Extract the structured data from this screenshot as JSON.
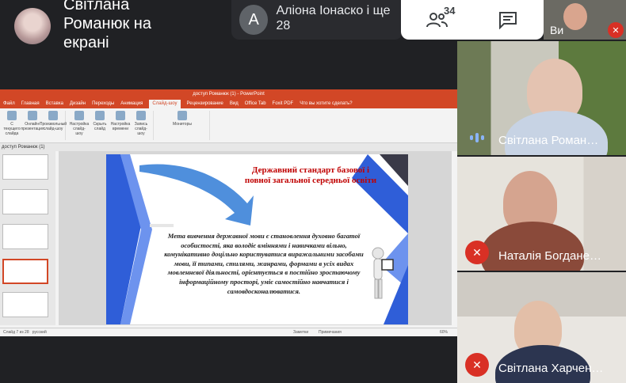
{
  "meet": {
    "presenter_label": "Світлана Романюк на екрані",
    "others_label": "Аліона Іонаско і ще 28",
    "others_initial": "A",
    "participant_count": "34",
    "self_label": "Ви"
  },
  "tiles": [
    {
      "name": "Світлана Роман…",
      "state": "speaking"
    },
    {
      "name": "Наталія Богдане…",
      "state": "muted"
    },
    {
      "name": "Світлана Харчен…",
      "state": "muted"
    }
  ],
  "powerpoint": {
    "window_title": "доступ Романюк (1) - PowerPoint",
    "tabs": [
      "Файл",
      "Главная",
      "Вставка",
      "Дизайн",
      "Переходы",
      "Анимация",
      "Слайд-шоу",
      "Рецензирование",
      "Вид",
      "Office Tab",
      "Foxit PDF",
      "Что вы хотите сделать?"
    ],
    "active_tab": "Слайд-шоу",
    "doc_tab": "доступ Романюк (1)",
    "status_left": "Слайд 7 из 28",
    "status_lang": "русский",
    "status_notes": "Заметки",
    "status_comments": "Примечания",
    "zoom": "60%",
    "ribbon": {
      "from_start": "С текущего слайда",
      "online": "Онлайн-презентация",
      "custom": "Произвольный слайд-шоу",
      "setup": "Настройка слайд-шоу",
      "hide": "Скрыть слайд",
      "rehearse": "Настройка времени",
      "record": "Запись слайд-шоу",
      "monitors": "Мониторы"
    }
  },
  "slide": {
    "title": "Державний стандарт базової і повної загальної середньої освіти",
    "body": "Мета вивчення державної мови є становлення духовно багатої особистості, яка володіє вміннями і навичками вільно, комунікативно доцільно користуватися виражальними засобами мови, її типами, стилями, жанрами, формами в усіх видах мовленнєвої діяльності, орієнтується в постійно зростаючому інформаційному просторі, уміє самостійно навчатися і самовдосконалюватися."
  },
  "colors": {
    "meet_bg": "#202124",
    "ppt_accent": "#d24726",
    "mute_red": "#d93025",
    "slide_title": "#c00000",
    "ribbon_blue": "#2f5ed8"
  }
}
